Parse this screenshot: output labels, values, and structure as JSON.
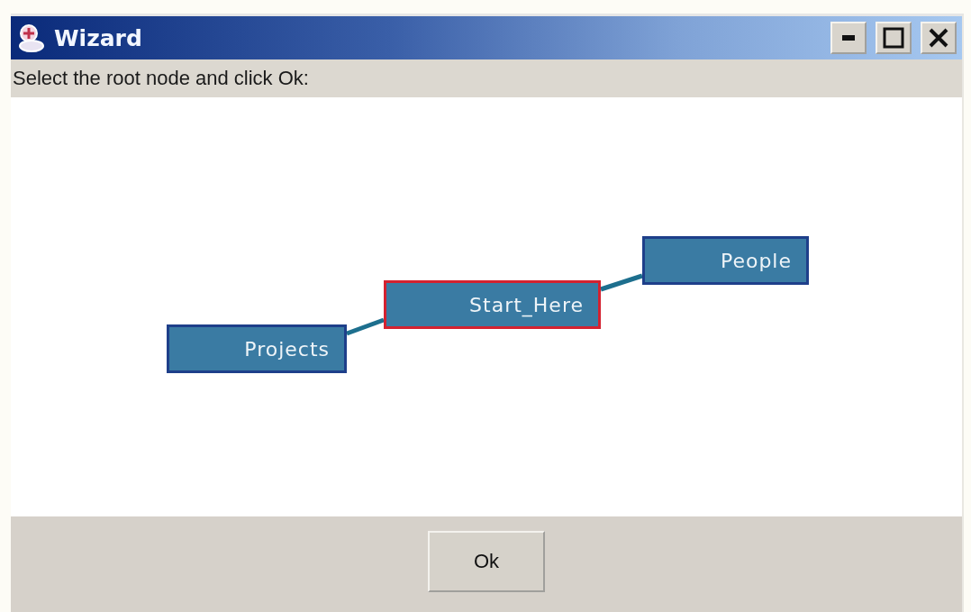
{
  "window": {
    "title": "Wizard"
  },
  "instruction": "Select the root node and click Ok:",
  "graph": {
    "nodes": [
      {
        "label": "Projects",
        "selected": false
      },
      {
        "label": "Start_Here",
        "selected": true
      },
      {
        "label": "People",
        "selected": false
      }
    ]
  },
  "buttons": [
    {
      "label": "Ok"
    }
  ]
}
